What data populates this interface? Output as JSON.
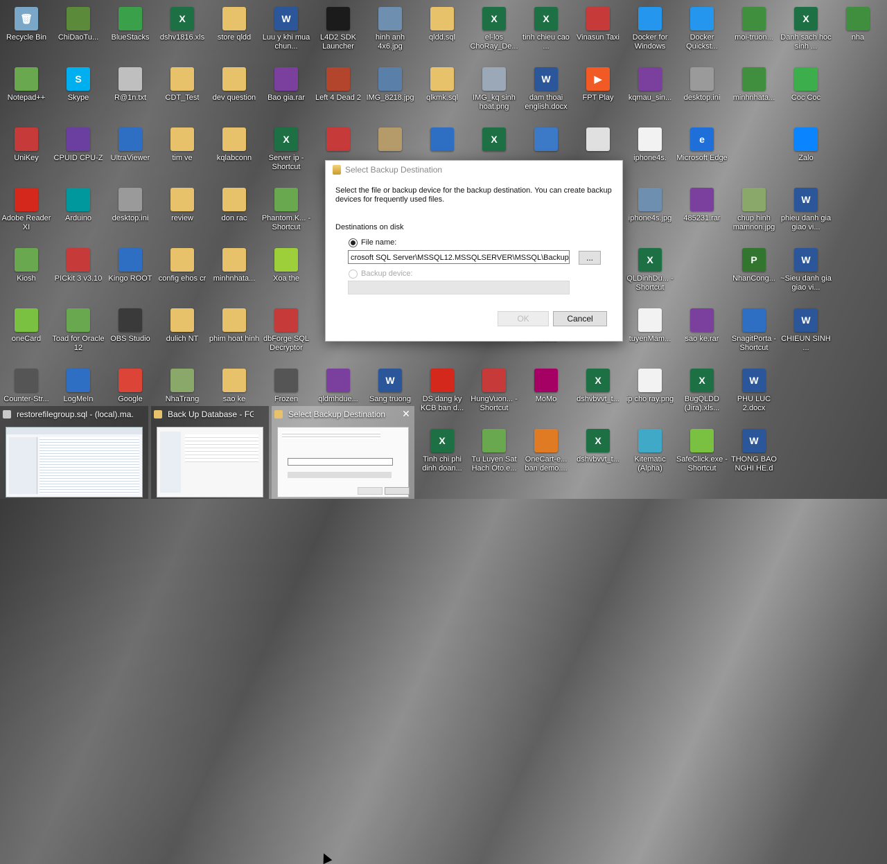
{
  "desktop": {
    "icons": [
      {
        "label": "Recycle Bin",
        "color": "#7aa7c7",
        "glyph": "🗑"
      },
      {
        "label": "ChiDaoTu...",
        "color": "#5b8a3a",
        "glyph": ""
      },
      {
        "label": "BlueStacks",
        "color": "#3aa14a",
        "glyph": ""
      },
      {
        "label": "dshv1816.xls",
        "color": "#1d7044",
        "glyph": "X"
      },
      {
        "label": "store qldd",
        "color": "#e8c26a",
        "glyph": ""
      },
      {
        "label": "Luu y khi mua chun...",
        "color": "#2b579a",
        "glyph": "W"
      },
      {
        "label": "L4D2 SDK Launcher",
        "color": "#1b1b1b",
        "glyph": ""
      },
      {
        "label": "hinh anh 4x6.jpg",
        "color": "#6f8fb0",
        "glyph": ""
      },
      {
        "label": "qldd.sql",
        "color": "#e8c26a",
        "glyph": ""
      },
      {
        "label": "el-los ChoRay_De...",
        "color": "#1d7044",
        "glyph": "X"
      },
      {
        "label": "tinh chieu cao ...",
        "color": "#1d7044",
        "glyph": "X"
      },
      {
        "label": "Vinasun Taxi",
        "color": "#c63a3a",
        "glyph": ""
      },
      {
        "label": "Docker for Windows",
        "color": "#2496ed",
        "glyph": ""
      },
      {
        "label": "Docker Quickst...",
        "color": "#2496ed",
        "glyph": ""
      },
      {
        "label": "moi-truon...",
        "color": "#3f8f3f",
        "glyph": ""
      },
      {
        "label": "Danh sach hoc sinh ...",
        "color": "#1d7044",
        "glyph": "X"
      },
      {
        "label": "Notepad++",
        "color": "#6aa84f",
        "glyph": ""
      },
      {
        "label": "Skype",
        "color": "#00aff0",
        "glyph": "S"
      },
      {
        "label": "R@1n.txt",
        "color": "#bfbfbf",
        "glyph": ""
      },
      {
        "label": "CDT_Test",
        "color": "#e8c26a",
        "glyph": ""
      },
      {
        "label": "dev question",
        "color": "#e8c26a",
        "glyph": ""
      },
      {
        "label": "Bao gia.rar",
        "color": "#7b3f9e",
        "glyph": ""
      },
      {
        "label": "Left 4 Dead 2",
        "color": "#b2452b",
        "glyph": ""
      },
      {
        "label": "IMG_8218.jpg",
        "color": "#5a7fa8",
        "glyph": ""
      },
      {
        "label": "qlkmk.sql",
        "color": "#e8c26a",
        "glyph": ""
      },
      {
        "label": "IMG_kq sinh hoat.png",
        "color": "#9aa8b8",
        "glyph": ""
      },
      {
        "label": "dam thoai english.docx",
        "color": "#2b579a",
        "glyph": "W"
      },
      {
        "label": "FPT Play",
        "color": "#f15a24",
        "glyph": "▶"
      },
      {
        "label": "kqmau_sin...",
        "color": "#7b3f9e",
        "glyph": ""
      },
      {
        "label": "desktop.ini",
        "color": "#9a9a9a",
        "glyph": ""
      },
      {
        "label": "minhnhata...",
        "color": "#3f8f3f",
        "glyph": ""
      },
      {
        "label": "Coc Coc",
        "color": "#3cae4c",
        "glyph": ""
      },
      {
        "label": "UniKey",
        "color": "#c63a3a",
        "glyph": ""
      },
      {
        "label": "CPUID CPU-Z",
        "color": "#6a3fa0",
        "glyph": ""
      },
      {
        "label": "UltraViewer",
        "color": "#2e6fc3",
        "glyph": ""
      },
      {
        "label": "tim ve",
        "color": "#e8c26a",
        "glyph": ""
      },
      {
        "label": "kqlabconn",
        "color": "#e8c26a",
        "glyph": ""
      },
      {
        "label": "Server ip - Shortcut",
        "color": "#1d7044",
        "glyph": "X"
      },
      {
        "label": "",
        "color": "#c63a3a",
        "glyph": ""
      },
      {
        "label": "",
        "color": "#b59a6a",
        "glyph": ""
      },
      {
        "label": "",
        "color": "#2e6fc3",
        "glyph": ""
      },
      {
        "label": "",
        "color": "#1d7044",
        "glyph": "X"
      },
      {
        "label": "",
        "color": "#3c79c6",
        "glyph": ""
      },
      {
        "label": "",
        "color": "#e0e0e0",
        "glyph": ""
      },
      {
        "label": "iphone4s.",
        "color": "#f2f2f2",
        "glyph": ""
      },
      {
        "label": "Microsoft Edge",
        "color": "#1e6fd9",
        "glyph": "e"
      },
      {
        "label": "Zalo",
        "color": "#0a84ff",
        "glyph": ""
      },
      {
        "label": "Adobe Reader XI",
        "color": "#d4281c",
        "glyph": ""
      },
      {
        "label": "Arduino",
        "color": "#00979d",
        "glyph": ""
      },
      {
        "label": "desktop.ini",
        "color": "#9a9a9a",
        "glyph": ""
      },
      {
        "label": "review",
        "color": "#e8c26a",
        "glyph": ""
      },
      {
        "label": "don rac",
        "color": "#e8c26a",
        "glyph": ""
      },
      {
        "label": "Phantom.K... - Shortcut",
        "color": "#6aa84f",
        "glyph": ""
      },
      {
        "label": "iphone4s.jpg",
        "color": "#6f8fb0",
        "glyph": ""
      },
      {
        "label": "485231.rar",
        "color": "#7b3f9e",
        "glyph": ""
      },
      {
        "label": "chup hinh mamnon.jpg",
        "color": "#8aa86a",
        "glyph": ""
      },
      {
        "label": "phieu danh gia giao vi...",
        "color": "#2b579a",
        "glyph": "W"
      },
      {
        "label": "Kiosh",
        "color": "#6aa84f",
        "glyph": ""
      },
      {
        "label": "PICkit 3 v3.10",
        "color": "#c63a3a",
        "glyph": ""
      },
      {
        "label": "Kingo ROOT",
        "color": "#2e6fc3",
        "glyph": ""
      },
      {
        "label": "config ehos cr",
        "color": "#e8c26a",
        "glyph": ""
      },
      {
        "label": "minhnhata...",
        "color": "#e8c26a",
        "glyph": ""
      },
      {
        "label": "Xoa the",
        "color": "#9ccf3a",
        "glyph": ""
      },
      {
        "label": "QLDinhDu... - Shortcut",
        "color": "#1d7044",
        "glyph": "X"
      },
      {
        "label": "NhanCong...",
        "color": "#31752f",
        "glyph": "P"
      },
      {
        "label": "~Sieu danh gia giao vi...",
        "color": "#2b579a",
        "glyph": "W"
      },
      {
        "label": "oneCard",
        "color": "#7ac142",
        "glyph": ""
      },
      {
        "label": "Toad for Oracle 12",
        "color": "#6aa84f",
        "glyph": ""
      },
      {
        "label": "OBS Studio",
        "color": "#3a3a3a",
        "glyph": ""
      },
      {
        "label": "dulich NT",
        "color": "#e8c26a",
        "glyph": ""
      },
      {
        "label": "phim hoat hinh",
        "color": "#e8c26a",
        "glyph": ""
      },
      {
        "label": "dbForge SQL Decryptor",
        "color": "#c63a3a",
        "glyph": ""
      },
      {
        "label": "Mobile",
        "color": "#555555",
        "glyph": ""
      },
      {
        "label": "tuyenMam...",
        "color": "#f2f2f2",
        "glyph": ""
      },
      {
        "label": "sao ke.rar",
        "color": "#7b3f9e",
        "glyph": ""
      },
      {
        "label": "SnagitPorta - Shortcut",
        "color": "#2e6fc3",
        "glyph": ""
      },
      {
        "label": "CHIEUN SINH ...",
        "color": "#2b579a",
        "glyph": "W"
      },
      {
        "label": "Counter-Str...",
        "color": "#555555",
        "glyph": ""
      },
      {
        "label": "LogMeIn",
        "color": "#2e6fc3",
        "glyph": ""
      },
      {
        "label": "Google",
        "color": "#db4437",
        "glyph": ""
      },
      {
        "label": "NhaTrang",
        "color": "#8aa86a",
        "glyph": ""
      },
      {
        "label": "sao ke",
        "color": "#e8c26a",
        "glyph": ""
      },
      {
        "label": "Frozen",
        "color": "#555555",
        "glyph": ""
      },
      {
        "label": "qldmhdue...",
        "color": "#7b3f9e",
        "glyph": ""
      },
      {
        "label": "Sang truong",
        "color": "#2b579a",
        "glyph": "W"
      },
      {
        "label": "DS dang ky KCB ban d...",
        "color": "#d4281c",
        "glyph": ""
      },
      {
        "label": "HungVuon... - Shortcut",
        "color": "#c63a3a",
        "glyph": ""
      },
      {
        "label": "MoMo",
        "color": "#a50064",
        "glyph": ""
      },
      {
        "label": "dshvbvvt_t...",
        "color": "#1d7044",
        "glyph": "X"
      },
      {
        "label": "ip cho ray.png",
        "color": "#f2f2f2",
        "glyph": ""
      },
      {
        "label": "BugQLDD (Jira).xls...",
        "color": "#1d7044",
        "glyph": "X"
      },
      {
        "label": "PHU LUC 2.docx",
        "color": "#2b579a",
        "glyph": "W"
      },
      {
        "label": "Tinh chi phi dinh doan...",
        "color": "#1d7044",
        "glyph": "X"
      },
      {
        "label": "Tu Luyen Sat Hach Oto.e...",
        "color": "#6aa84f",
        "glyph": ""
      },
      {
        "label": "OneCart-e... ban demo....",
        "color": "#e07b24",
        "glyph": ""
      },
      {
        "label": "dshvbvvt_t...",
        "color": "#1d7044",
        "glyph": "X"
      },
      {
        "label": "Kitematic (Alpha)",
        "color": "#3fa9c7",
        "glyph": ""
      },
      {
        "label": "SafeClick.exe - Shortcut",
        "color": "#7ac142",
        "glyph": ""
      },
      {
        "label": "THONG BAO NGHI HE.d",
        "color": "#2b579a",
        "glyph": "W"
      },
      {
        "label": "nha",
        "color": "#3f8f3f",
        "glyph": ""
      }
    ]
  },
  "dialog": {
    "title": "Select Backup Destination",
    "description": "Select the file or backup device for the backup destination. You can create backup devices for frequently used files.",
    "section_label": "Destinations on disk",
    "file_name_label": "File name:",
    "file_name_value": "crosoft SQL Server\\MSSQL12.MSSQLSERVER\\MSSQL\\Backup\\",
    "browse_label": "...",
    "backup_device_label": "Backup device:",
    "backup_device_value": "",
    "ok_label": "OK",
    "cancel_label": "Cancel"
  },
  "taskbar_thumbnails": [
    {
      "title": "restorefilegroup.sql - (local).ma...",
      "icon_color": "#c8c8c8"
    },
    {
      "title": "Back Up Database - FG...",
      "icon_color": "#e8c26a"
    },
    {
      "title": "Select Backup Destination",
      "icon_color": "#e8c26a",
      "close": "✕"
    }
  ]
}
